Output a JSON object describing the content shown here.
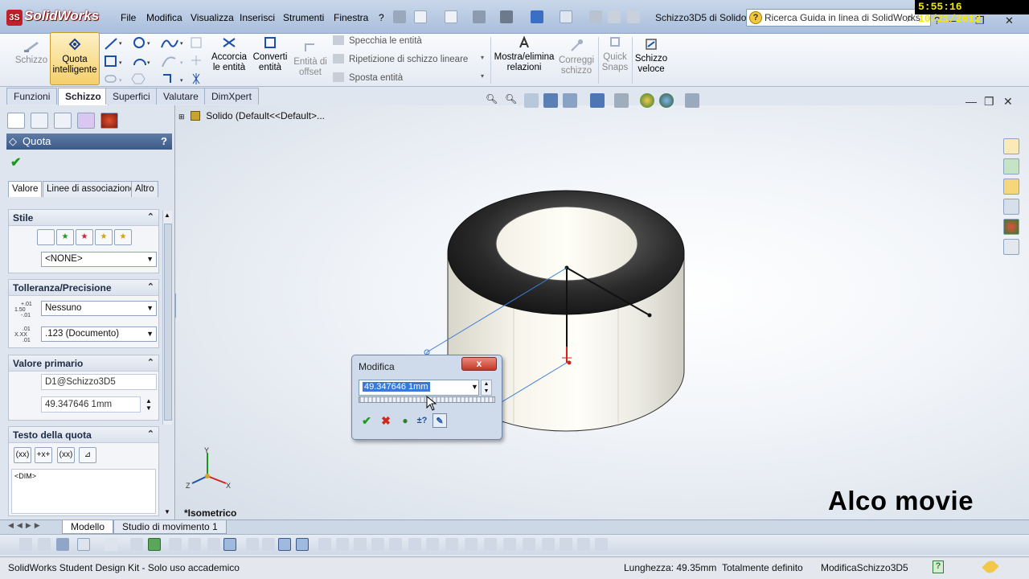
{
  "app": {
    "logo_text": "SolidWorks",
    "logo_mark": "3S",
    "doc_title": "Schizzo3D5 di Solido *",
    "clock": "5:55:16 10/21/2012",
    "search_placeholder": "Ricerca Guida in linea di SolidWorks",
    "menu": [
      "File",
      "Modifica",
      "Visualizza",
      "Inserisci",
      "Strumenti",
      "Finestra",
      "?"
    ]
  },
  "ribbon": {
    "schizzo": "Schizzo",
    "quota_line1": "Quota",
    "quota_line2": "intelligente",
    "accorcia_line1": "Accorcia",
    "accorcia_line2": "le entità",
    "converti_line1": "Converti",
    "converti_line2": "entità",
    "offset_line1": "Entità di",
    "offset_line2": "offset",
    "specchia": "Specchia le entità",
    "ripetizione": "Ripetizione di schizzo lineare",
    "sposta": "Sposta entità",
    "mostra_line1": "Mostra/elimina",
    "mostra_line2": "relazioni",
    "correggi_line1": "Correggi",
    "correggi_line2": "schizzo",
    "quick_line1": "Quick",
    "quick_line2": "Snaps",
    "veloce_line1": "Schizzo",
    "veloce_line2": "veloce"
  },
  "tabs": [
    "Funzioni",
    "Schizzo",
    "Superfici",
    "Valutare",
    "DimXpert"
  ],
  "pm": {
    "title": "Quota",
    "help": "?",
    "subtabs": [
      "Valore",
      "Linee di associazione",
      "Altro"
    ],
    "stile": {
      "head": "Stile",
      "combo": "<NONE>"
    },
    "tolleranza": {
      "head": "Tolleranza/Precisione",
      "tol_combo": "Nessuno",
      "prec_combo": ".123 (Documento)",
      "tol_icon_main": "1.50",
      "tol_icon_plus": "+.01",
      "tol_icon_minus": "-.01",
      "prec_icon_main": "X.XX",
      "prec_icon_top": ".01",
      "prec_icon_bottom": ".01"
    },
    "valore": {
      "head": "Valore primario",
      "name": "D1@Schizzo3D5",
      "value": "49.347646 1mm"
    },
    "testo": {
      "head": "Testo della quota",
      "text": "<DIM>",
      "btn_labels": [
        "(xx)",
        "+x+",
        "(xx)",
        "⊿"
      ]
    }
  },
  "graphics": {
    "tree_item": "Solido  (Default<<Default>...",
    "view_name": "*Isometrico",
    "watermark": "Alco movie"
  },
  "dialog": {
    "title": "Modifica",
    "value": "49.347646 1mm",
    "close": "x"
  },
  "bottom_tabs": [
    "Modello",
    "Studio di movimento 1"
  ],
  "status": {
    "product": "SolidWorks Student Design Kit - Solo uso accademico",
    "length": "Lunghezza: 49.35mm",
    "state": "Totalmente definito",
    "mode": "ModificaSchizzo3D5"
  },
  "colors": {
    "accent": "#3c5a87",
    "ok_green": "#1c9a1c",
    "cancel_red": "#cc2a1a",
    "clock_text": "#f5e800"
  }
}
